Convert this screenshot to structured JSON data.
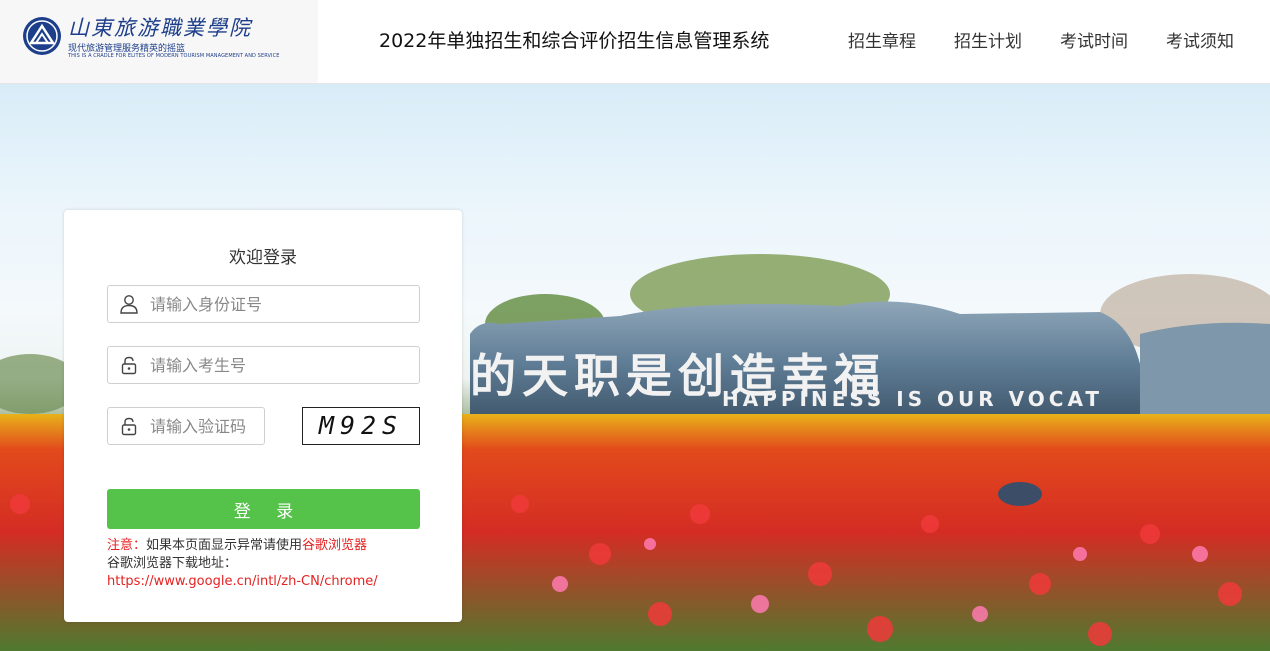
{
  "header": {
    "logo_cn": "山東旅游職業學院",
    "logo_slogan": "现代旅游管理服务精英的摇篮",
    "logo_en": "THIS IS A CRADLE FOR ELITES OF MODERN TOURISM MANAGEMENT AND SERVICE",
    "system_title": "2022年单独招生和综合评价招生信息管理系统",
    "nav": [
      {
        "label": "招生章程"
      },
      {
        "label": "招生计划"
      },
      {
        "label": "考试时间"
      },
      {
        "label": "考试须知"
      }
    ]
  },
  "hero": {
    "rock_cn": "的天职是创造幸福",
    "rock_en": "HAPPINESS IS OUR VOCAT"
  },
  "login": {
    "title": "欢迎登录",
    "id_placeholder": "请输入身份证号",
    "exam_no_placeholder": "请输入考生号",
    "captcha_placeholder": "请输入验证码",
    "captcha_text": "M92S",
    "submit_label": "登 录",
    "notice_prefix": "注意：",
    "notice_text": "如果本页面显示异常请使用",
    "notice_browser": "谷歌浏览器",
    "download_label": "谷歌浏览器下载地址：",
    "download_url": "https://www.google.cn/intl/zh-CN/chrome/"
  },
  "colors": {
    "brand_blue": "#1d3e8a",
    "login_green": "#55c24a",
    "notice_red": "#e42222"
  }
}
